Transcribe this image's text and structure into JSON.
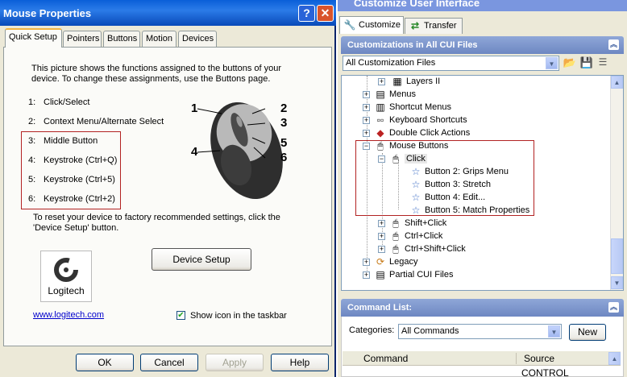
{
  "mouse_dialog": {
    "title": "Mouse Properties",
    "help_btn": "?",
    "close_btn": "✕",
    "tabs": [
      "Quick Setup",
      "Pointers",
      "Buttons",
      "Motion",
      "Devices"
    ],
    "intro": [
      "This picture shows the functions assigned to the buttons of your",
      "device.  To change these assignments, use the Buttons page."
    ],
    "assignments": [
      {
        "num": "1:",
        "label": "Click/Select"
      },
      {
        "num": "2:",
        "label": "Context Menu/Alternate Select"
      },
      {
        "num": "3:",
        "label": "Middle Button"
      },
      {
        "num": "4:",
        "label": "Keystroke (Ctrl+Q)"
      },
      {
        "num": "5:",
        "label": "Keystroke (Ctrl+5)"
      },
      {
        "num": "6:",
        "label": "Keystroke (Ctrl+2)"
      }
    ],
    "callouts": [
      "1",
      "2",
      "3",
      "4",
      "5",
      "6"
    ],
    "reset_text": [
      "To reset your device to factory recommended settings, click the",
      "'Device Setup' button."
    ],
    "device_setup_btn": "Device Setup",
    "logo_text": "Logitech",
    "link": "www.logitech.com",
    "show_icon_label": "Show icon in the taskbar",
    "show_icon_checked": true,
    "buttons": {
      "ok": "OK",
      "cancel": "Cancel",
      "apply": "Apply",
      "help": "Help"
    }
  },
  "cui": {
    "title": "Customize User Interface",
    "tabs": {
      "customize": "Customize",
      "transfer": "Transfer"
    },
    "section_title": "Customizations in All CUI Files",
    "files_combo": "All Customization Files",
    "tree": {
      "layers": "Layers II",
      "menus": "Menus",
      "shortcut_menus": "Shortcut Menus",
      "keyboard_shortcuts": "Keyboard Shortcuts",
      "double_click": "Double Click Actions",
      "mouse_buttons": "Mouse Buttons",
      "click": "Click",
      "click_children": [
        "Button 2: Grips Menu",
        "Button 3: Stretch",
        "Button 4: Edit...",
        "Button 5: Match Properties"
      ],
      "shift_click": "Shift+Click",
      "ctrl_click": "Ctrl+Click",
      "ctrl_shift_click": "Ctrl+Shift+Click",
      "legacy": "Legacy",
      "partial": "Partial CUI Files"
    },
    "command_list": {
      "title": "Command List:",
      "categories_label": "Categories:",
      "categories_value": "All Commands",
      "new_btn": "New",
      "col_command": "Command",
      "col_source": "Source",
      "first_source": "CONTROL"
    }
  }
}
